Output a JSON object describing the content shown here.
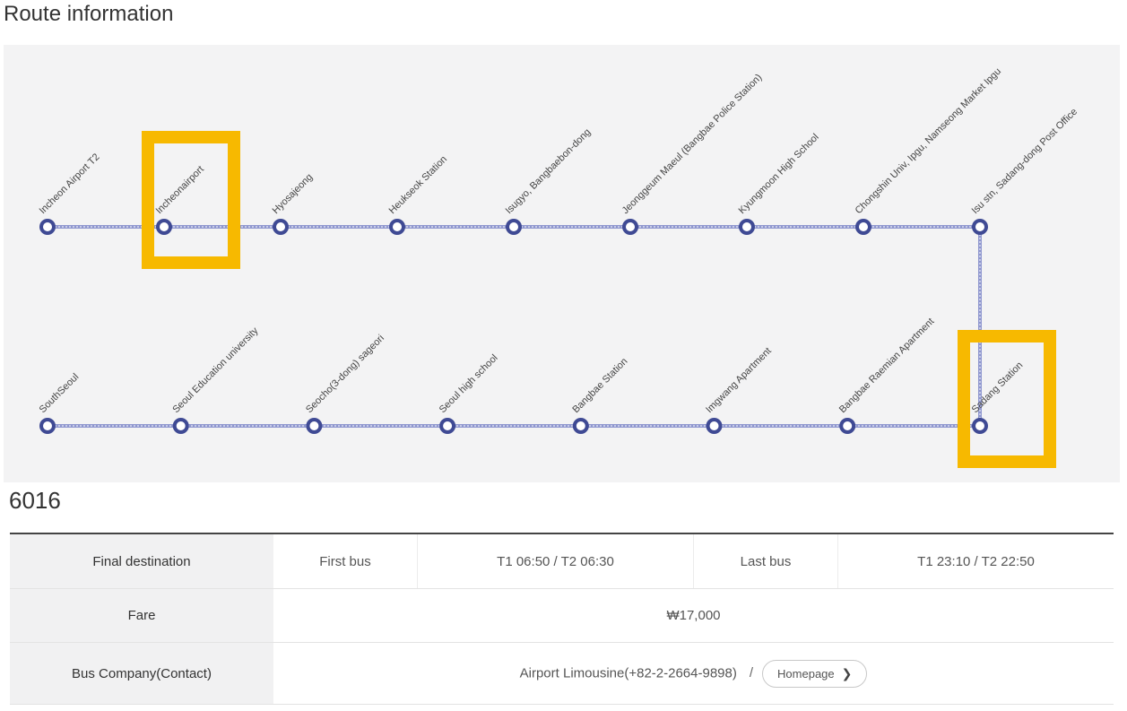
{
  "page": {
    "section_title": "Route information",
    "route_number": "6016"
  },
  "route": {
    "top_row": [
      "Incheon Airport T2",
      "Incheonairport",
      "Hyosajeong",
      "Heukseok Station",
      "Isugyo, Bangbaebon-dong",
      "Jeonggeum Maeul (Bangbae Police Station)",
      "Kyungmoon High School",
      "Chongshin Univ, Ipgu, Namseong Market Ipgu",
      "Isu stn, Sadang-dong Post Office"
    ],
    "bottom_row": [
      "SouthSeoul",
      "Seoul Education university",
      "Seocho(3-dong) sageori",
      "Seoul high school",
      "Bangbae Station",
      "Imgwang Apartment",
      "Bangbae Raemian Apartment",
      "Sadang Station"
    ],
    "highlighted_stops": [
      "Incheonairport",
      "Sadang Station"
    ],
    "colors": {
      "line": "#8f97cf",
      "line_dash": "#ffffff",
      "stop": "#3f4a94",
      "highlight": "#f7b900"
    }
  },
  "info": {
    "final_destination_label": "Final destination",
    "first_bus_label": "First bus",
    "first_bus_value": "T1 06:50 / T2 06:30",
    "last_bus_label": "Last bus",
    "last_bus_value": "T1 23:10 / T2 22:50",
    "fare_label": "Fare",
    "fare_value": "₩17,000",
    "company_label": "Bus Company(Contact)",
    "company_value": "Airport Limousine(+82-2-2664-9898)",
    "separator": "/",
    "homepage_label": "Homepage"
  }
}
